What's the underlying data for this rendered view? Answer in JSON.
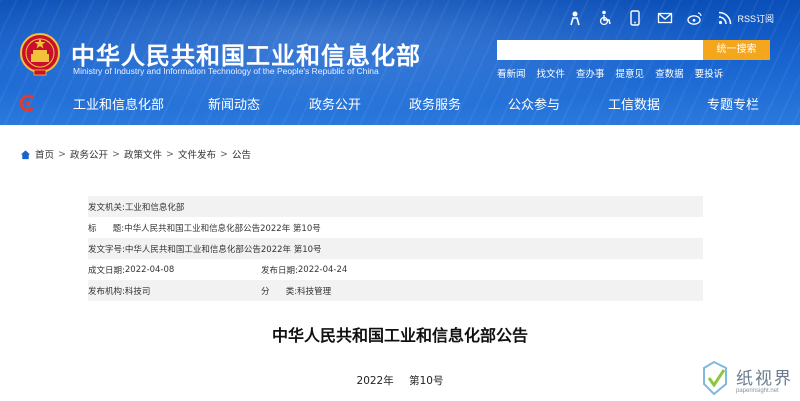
{
  "header": {
    "title": "中华人民共和国工业和信息化部",
    "subtitle": "Ministry of Industry and Information Technology of the People's Republic of China",
    "top_icons": [
      "accessibility-elder-icon",
      "wheelchair-icon",
      "mobile-icon",
      "mail-icon",
      "weibo-icon",
      "rss-icon"
    ],
    "rss_label": "RSS订阅",
    "search": {
      "placeholder": "",
      "button_label": "统一搜索"
    },
    "quick_links": [
      "看新闻",
      "找文件",
      "查办事",
      "提意见",
      "查数据",
      "要投诉"
    ]
  },
  "nav": {
    "items": [
      "工业和信息化部",
      "新闻动态",
      "政务公开",
      "政务服务",
      "公众参与",
      "工信数据",
      "专题专栏"
    ]
  },
  "breadcrumb": {
    "items": [
      "首页",
      "政务公开",
      "政策文件",
      "文件发布",
      "公告"
    ],
    "separator": ">"
  },
  "doc_info": {
    "issuer_label": "发文机关:",
    "issuer": "工业和信息化部",
    "title_label": "标      题:",
    "title": "中华人民共和国工业和信息化部公告2022年 第10号",
    "doc_no_label": "发文字号:",
    "doc_no": "中华人民共和国工业和信息化部公告2022年 第10号",
    "created_label": "成文日期:",
    "created": "2022-04-08",
    "published_label": "发布日期:",
    "published": "2022-04-24",
    "org_label": "发布机构:",
    "org": "科技司",
    "category_label": "分      类:",
    "category": "科技管理"
  },
  "document": {
    "title": "中华人民共和国工业和信息化部公告",
    "year": "2022年",
    "number": "第10号"
  },
  "watermark": {
    "text": "纸视界",
    "url": "paperinsight.net"
  },
  "colors": {
    "header_blue": "#1763cf",
    "search_orange": "#f4a71d",
    "row_shade": "#f2f2f2"
  }
}
